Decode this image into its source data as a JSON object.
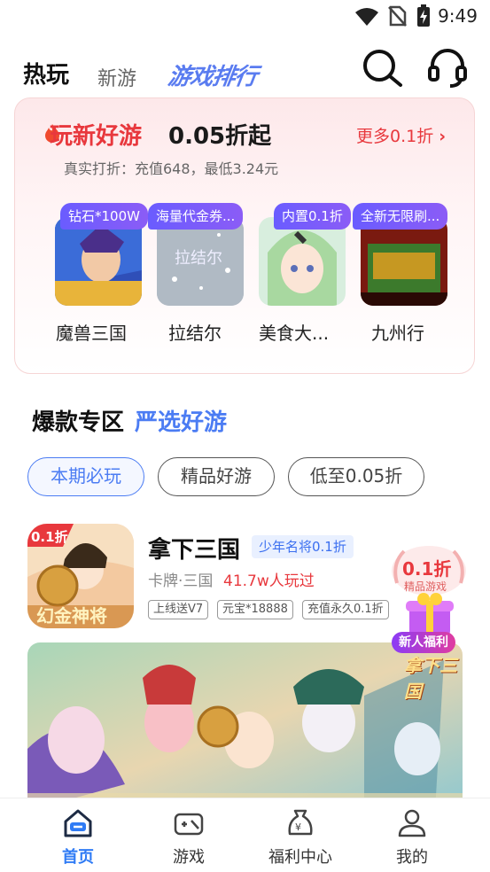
{
  "status_bar": {
    "time": "9:49"
  },
  "header": {
    "tabs": [
      {
        "label": "热玩"
      },
      {
        "label": "新游"
      },
      {
        "label": "游戏排行"
      }
    ]
  },
  "discount": {
    "title_red": "玩新好游",
    "title_black": "0.05折起",
    "more_label": "更多0.1折 ",
    "subtitle": "真实打折：充值648，最低3.24元",
    "games": [
      {
        "badge": "钻石*100W",
        "name": "魔兽三国"
      },
      {
        "badge": "海量代金券...",
        "name": "拉结尔"
      },
      {
        "badge": "内置0.1折",
        "name": "美食大..."
      },
      {
        "badge": "全新无限刷...",
        "name": "九州行"
      }
    ]
  },
  "hot_section": {
    "title": "爆款专区",
    "subtitle": "严选好游",
    "chips": [
      {
        "label": "本期必玩",
        "active": true
      },
      {
        "label": "精品好游",
        "active": false
      },
      {
        "label": "低至0.05折",
        "active": false
      }
    ]
  },
  "featured_game": {
    "icon_badge": "0.1折",
    "icon_caption": "幻金神将",
    "name": "拿下三国",
    "tag": "少年名将0.1折",
    "category": "卡牌·三国",
    "players": "41.7w人玩过",
    "chips": [
      "上线送V7",
      "元宝*18888",
      "充值永久0.1折"
    ]
  },
  "promo": {
    "discount": "0.1折",
    "caption": "精品游戏",
    "ribbon": "新人福利"
  },
  "banner": {
    "logo_text": "拿下三国"
  },
  "bottom_nav": {
    "items": [
      {
        "label": "首页",
        "active": true
      },
      {
        "label": "游戏",
        "active": false
      },
      {
        "label": "福利中心",
        "active": false
      },
      {
        "label": "我的",
        "active": false
      }
    ]
  },
  "colors": {
    "accent_blue": "#4b7cf3",
    "accent_red": "#e8383d",
    "badge_purple": "#6a5cff"
  }
}
